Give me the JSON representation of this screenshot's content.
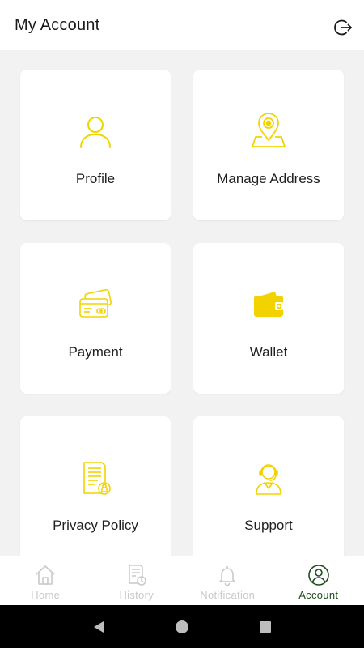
{
  "header": {
    "title": "My Account",
    "logout_icon": "logout-icon"
  },
  "colors": {
    "accent": "#f2d300",
    "active_nav": "#1d4d1d",
    "inactive_nav": "#c9c9c9"
  },
  "cards": [
    {
      "label": "Profile",
      "icon": "profile-icon"
    },
    {
      "label": "Manage Address",
      "icon": "location-pin-icon"
    },
    {
      "label": "Payment",
      "icon": "credit-card-icon"
    },
    {
      "label": "Wallet",
      "icon": "wallet-icon"
    },
    {
      "label": "Privacy Policy",
      "icon": "document-lock-icon"
    },
    {
      "label": "Support",
      "icon": "support-agent-icon"
    }
  ],
  "bottom_nav": [
    {
      "label": "Home",
      "icon": "home-icon",
      "active": false
    },
    {
      "label": "History",
      "icon": "history-icon",
      "active": false
    },
    {
      "label": "Notification",
      "icon": "bell-icon",
      "active": false
    },
    {
      "label": "Account",
      "icon": "account-icon",
      "active": true
    }
  ],
  "system_nav": [
    "back-icon",
    "home-circle-icon",
    "recents-icon"
  ]
}
